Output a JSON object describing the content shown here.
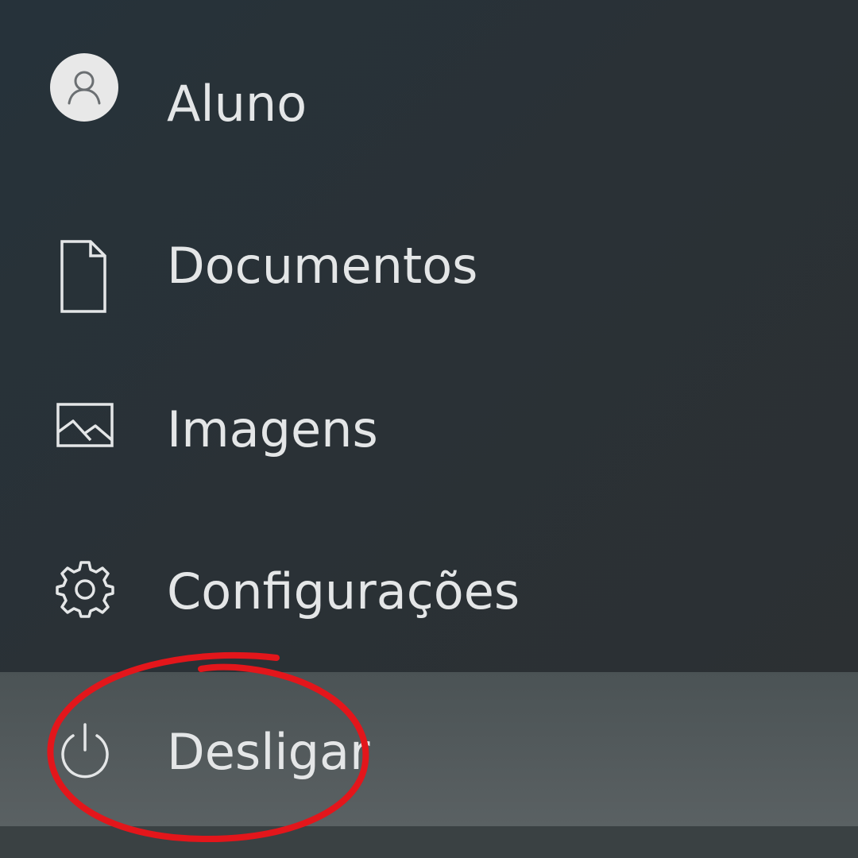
{
  "menu": {
    "items": [
      {
        "label": "Aluno",
        "icon": "user-avatar-icon"
      },
      {
        "label": "Documentos",
        "icon": "document-icon"
      },
      {
        "label": "Imagens",
        "icon": "image-icon"
      },
      {
        "label": "Configurações",
        "icon": "gear-icon"
      },
      {
        "label": "Desligar",
        "icon": "power-icon",
        "active": true
      }
    ]
  },
  "annotation": {
    "color": "#e3161b",
    "target": "Desligar"
  },
  "colors": {
    "background": "#2a3136",
    "active_background": "#545b5d",
    "text": "#e4e6e7"
  }
}
